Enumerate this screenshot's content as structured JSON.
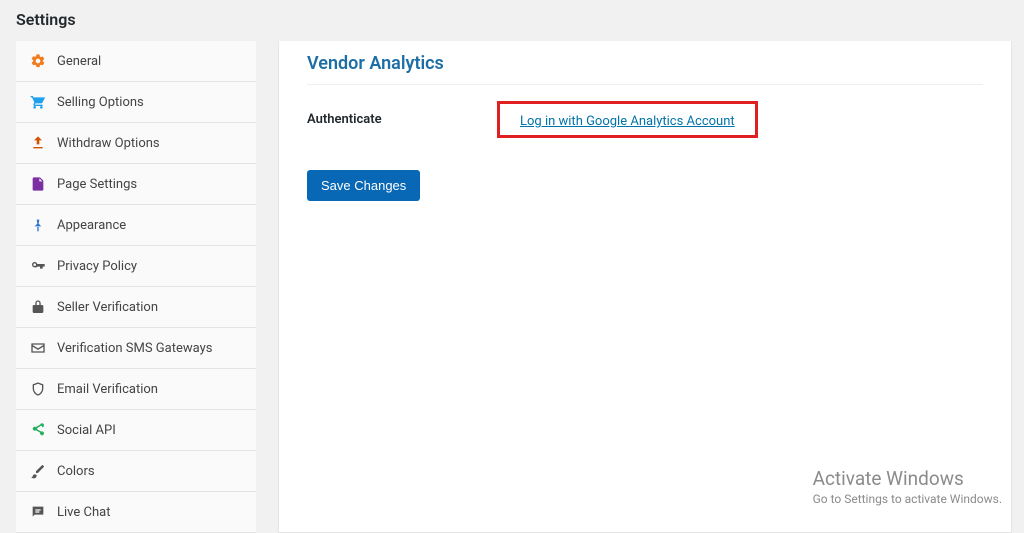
{
  "page": {
    "title": "Settings"
  },
  "sidebar": {
    "items": [
      {
        "label": "General",
        "icon_color": "#f07c1f"
      },
      {
        "label": "Selling Options",
        "icon_color": "#1ea0ef"
      },
      {
        "label": "Withdraw Options",
        "icon_color": "#d35400"
      },
      {
        "label": "Page Settings",
        "icon_color": "#7b2fa0"
      },
      {
        "label": "Appearance",
        "icon_color": "#2f74d0"
      },
      {
        "label": "Privacy Policy",
        "icon_color": "#555"
      },
      {
        "label": "Seller Verification",
        "icon_color": "#555"
      },
      {
        "label": "Verification SMS Gateways",
        "icon_color": "#555"
      },
      {
        "label": "Email Verification",
        "icon_color": "#555"
      },
      {
        "label": "Social API",
        "icon_color": "#27ae60"
      },
      {
        "label": "Colors",
        "icon_color": "#555"
      },
      {
        "label": "Live Chat",
        "icon_color": "#555"
      }
    ]
  },
  "main": {
    "section_title": "Vendor Analytics",
    "authenticate_label": "Authenticate",
    "auth_link_text": "Log in with Google Analytics Account",
    "save_label": "Save Changes"
  },
  "watermark": {
    "title": "Activate Windows",
    "subtitle": "Go to Settings to activate Windows."
  }
}
